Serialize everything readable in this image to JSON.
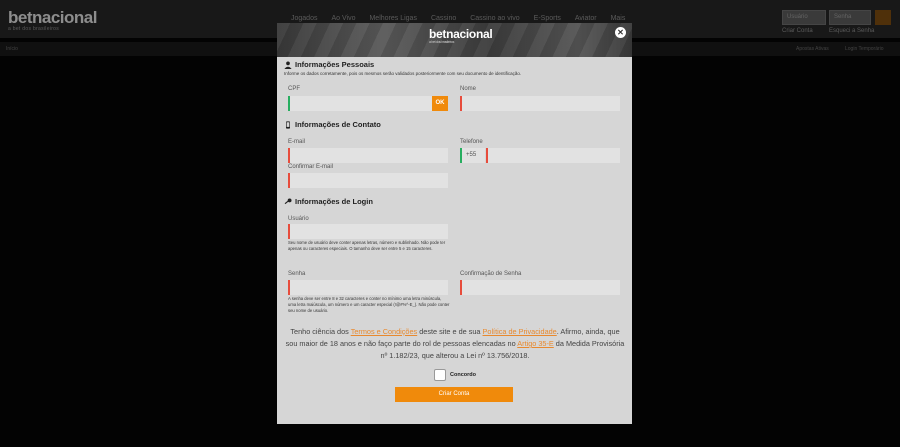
{
  "site": {
    "logo": "betnacional",
    "tagline": "a bet dos brasileiros",
    "nav": [
      "Jogados",
      "Ao Vivo",
      "Melhores Ligas",
      "Cassino",
      "Cassino ao vivo",
      "E-Sports",
      "Aviator",
      "Mais"
    ],
    "login": {
      "user_placeholder": "Usuário",
      "pass_placeholder": "Senha",
      "create_link": "Criar Conta",
      "forgot_link": "Esqueci a Senha"
    },
    "subbar": {
      "left": "Início",
      "right1": "Apostas Ativas",
      "right2": "Login Temporário"
    }
  },
  "modal": {
    "logo": "betnacional",
    "logo_tagline": "a bet dos brasileiros",
    "close_glyph": "✕",
    "personal": {
      "title": "Informações Pessoais",
      "desc": "Informe os dados corretamente, pois os mesmos serão validados posteriormente com seu documento de identificação.",
      "cpf_label": "CPF",
      "ok_label": "OK",
      "name_label": "Nome"
    },
    "contact": {
      "title": "Informações de Contato",
      "email_label": "E-mail",
      "phone_label": "Telefone",
      "phone_prefix": "+55",
      "confirm_email_label": "Confirmar E-mail"
    },
    "login": {
      "title": "Informações de Login",
      "user_label": "Usuário",
      "user_help": "Seu nome de usuário deve conter apenas letras, número e sublinhado. Não pode ter apenas ou caracteres especiais. O tamanho deve ser entre 5 e 15 caracteres.",
      "pass_label": "Senha",
      "pass_help": "A senha deve ser entre 8 e 32 caracteres e conter no mínimo uma letra minúscula, uma letra maiúscula, um número e um caracter especial (!@#%^-E_). Não pode conter seu nome de usuário.",
      "confirm_pass_label": "Confirmação de Senha"
    },
    "terms": {
      "part1": "Tenho ciência dos ",
      "link1": "Termos e Condições",
      "part2": " deste site e de sua ",
      "link2": "Política de Privacidade",
      "part3": ". Afirmo, ainda, que sou maior de 18 anos e não faço parte do rol de pessoas elencadas no ",
      "link3": "Artigo 35-E",
      "part4": " da Medida Provisória nº 1.182/23, que alterou a Lei nº 13.756/2018."
    },
    "agree_label": "Concordo",
    "submit_label": "Criar Conta",
    "colors": {
      "accent": "#f08a0b",
      "error": "#e74c3c",
      "valid": "#27ae60"
    }
  }
}
